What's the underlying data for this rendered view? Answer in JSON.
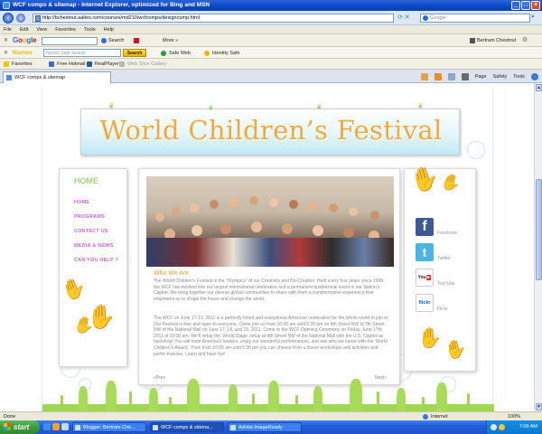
{
  "window": {
    "title": "WCF comps & sitemap - Internet Explorer, optimized for Bing and MSN"
  },
  "address": {
    "url": "http://bchestnut.aaltes.com/courses/md210/wcfcomps/designcomp.html",
    "search_placeholder": "Google"
  },
  "menu": [
    "File",
    "Edit",
    "View",
    "Favorites",
    "Tools",
    "Help"
  ],
  "google_toolbar": {
    "search_label": "Search",
    "popup_label": "",
    "more_label": "More »",
    "user": "Bertram Chestnut"
  },
  "norton_toolbar": {
    "logo": "Norton",
    "search_placeholder": "Norton Safe Search",
    "search_button": "Search",
    "safe_web": "Safe Web",
    "identity_safe": "Identity Safe"
  },
  "favorites_bar": {
    "favorites": "Favorites",
    "items": [
      "Free Hotmail",
      "RealPlayer",
      "Web Slice Gallery"
    ]
  },
  "tab": {
    "label": "WCF comps & sitemap"
  },
  "command_bar": [
    "Page",
    "Safety",
    "Tools"
  ],
  "site": {
    "banner_title": "World Children’s Festival",
    "nav": {
      "current": "HOME",
      "links": [
        "HOME",
        "PROGRAMS",
        "CONTACT US",
        "MEDIA & NEWS",
        "CAN YOU HELP ?"
      ]
    },
    "section_title": "Who We Are",
    "paragraph1": "The World Children’s Festival is the “Olympics” of our Creativity and Co-Creation. Held every four years since 1999, the WCF has evolved into our largest international celebration and a permanent quadrennial event in our Nation’s Capital. We bring together our diverse global communities to share with them a transformative experience that empowers us to shape the future and change the world.",
    "paragraph2": "The WCF on June 17-19, 2011 is a perfectly timed and exceptional American celebration for the whole world to join in. Our Festival is free and open to everyone. Come join us from 10:00 am until 5:30 pm on 4th Street NW to 7th Street NW of the National Mall on June 17, 18, and 19, 2011. Come to the WCF Opening Ceremony on Friday, June 17th, 2011 at 10:00 am. We’ll setup the ‘World Stage’ setup at 4th Street NW of the National Mall with the U.S. Capitol as backdrop! You will meet America’s leaders, enjoy our wonderful performances, and see who we honor with the ‘World Children’s Award’. Then from 10:00 am until 5:30 pm you can choose from a dozen workshops and activities and perfor-mances. Learn and have fun!",
    "prev": "«Prev",
    "next": "Next»",
    "social": [
      {
        "label": "Facebook",
        "glyph": "f"
      },
      {
        "label": "Twitter",
        "glyph": "t"
      },
      {
        "label": "YouTube",
        "glyph": "You"
      },
      {
        "label": "Flickr",
        "glyph": "flickr"
      }
    ]
  },
  "status": {
    "text": "Done",
    "zone": "Internet",
    "zoom": "100%"
  },
  "taskbar": {
    "start": "start",
    "tasks": [
      "Blogger: Bertram Che...",
      "WCF comps & sitema...",
      "Adobe ImageReady"
    ],
    "clock": "7:09 AM"
  }
}
